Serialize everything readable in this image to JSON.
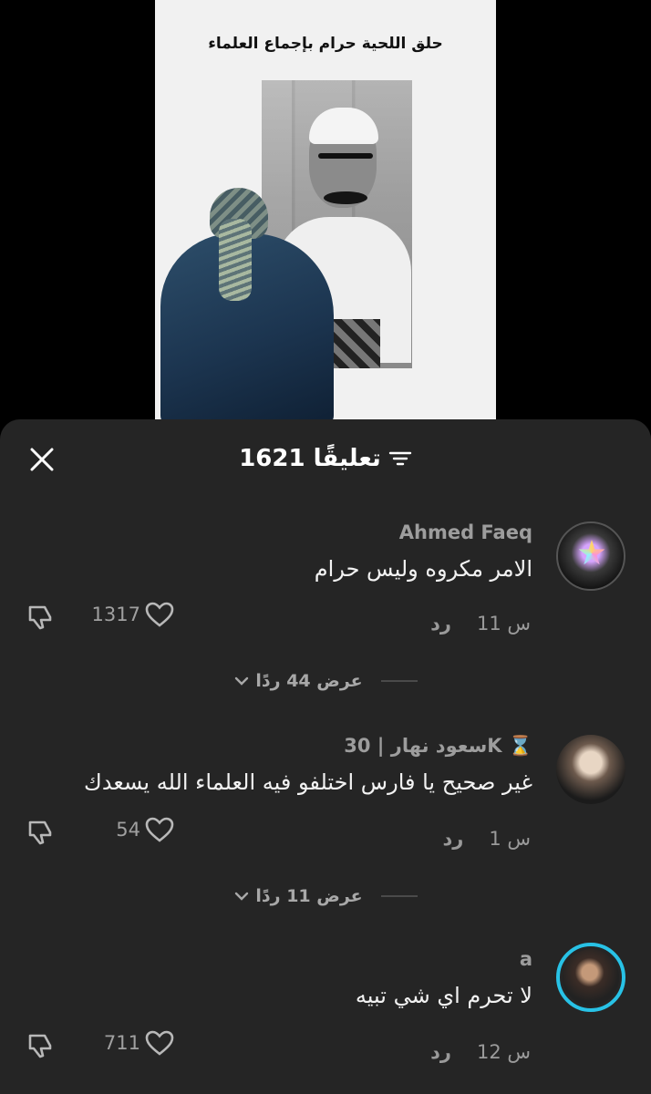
{
  "video": {
    "caption": "حلق اللحية حرام بإجماع العلماء"
  },
  "header": {
    "count_title": "1621 تعليقًا",
    "close_icon": "close-icon",
    "filter_icon": "filter-icon"
  },
  "comments": [
    {
      "author": "Ahmed Faeq",
      "text": "الامر مكروه وليس حرام",
      "time": "11 س",
      "reply_label": "رد",
      "likes": "1317",
      "view_replies": "عرض 44 ردًا"
    },
    {
      "author": "سعود نهار | 30K ⌛",
      "text": "غير صحيح يا فارس اختلفو فيه العلماء الله يسعدك",
      "time": "1 س",
      "reply_label": "رد",
      "likes": "54",
      "view_replies": "عرض 11 ردًا"
    },
    {
      "author": "a",
      "text": "لا تحرم اي شي تبيه",
      "time": "12 س",
      "reply_label": "رد",
      "likes": "711"
    }
  ]
}
